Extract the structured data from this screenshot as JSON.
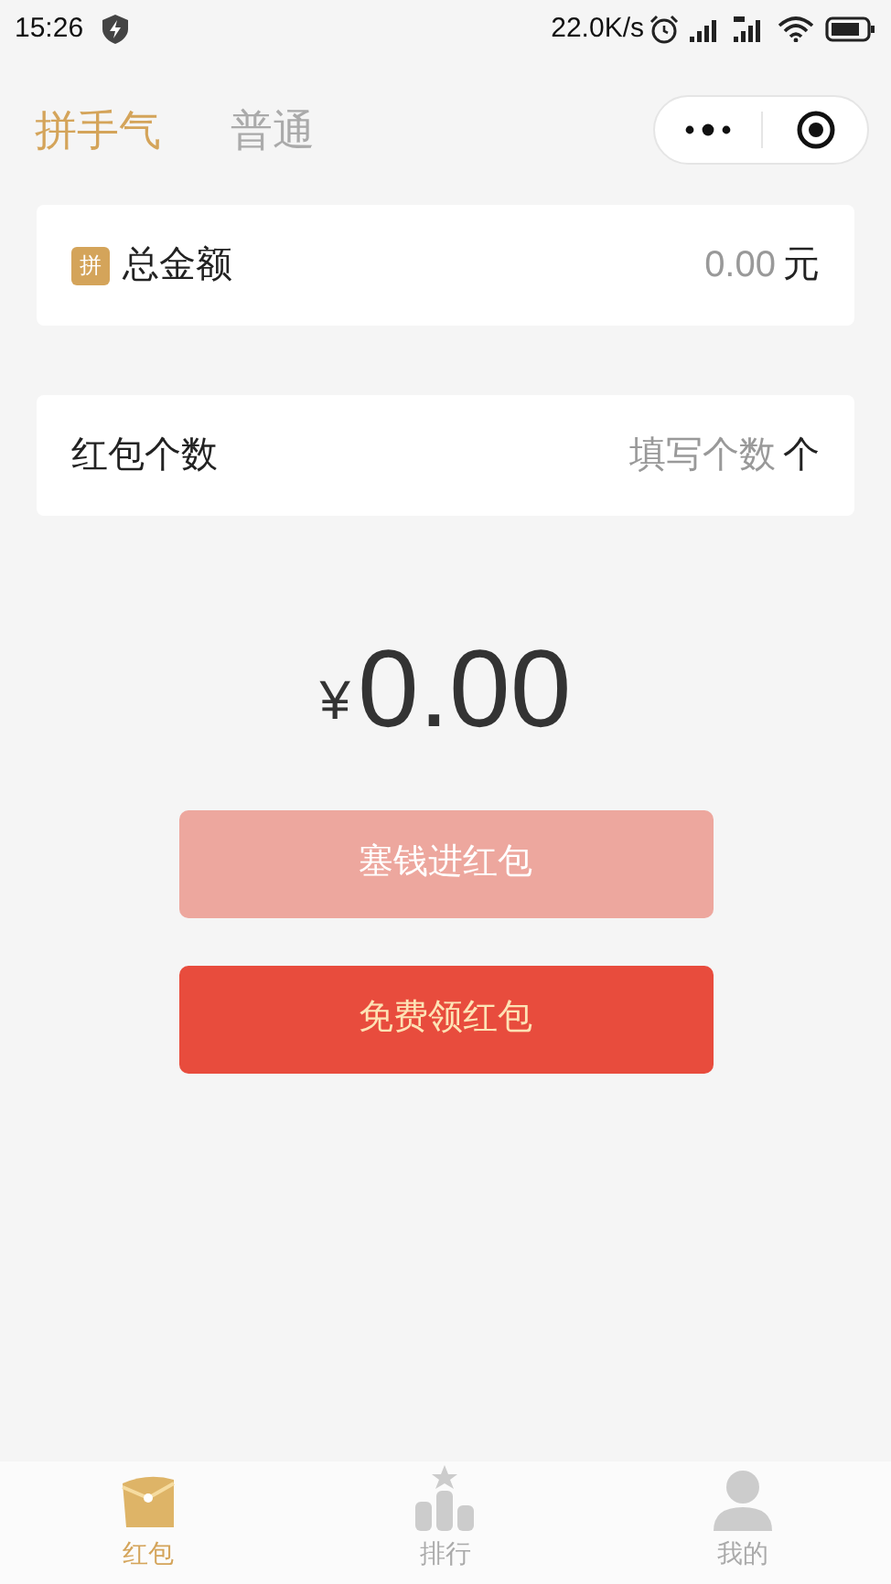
{
  "status_bar": {
    "time": "15:26",
    "speed": "22.0K/s"
  },
  "tabs": [
    {
      "label": "拼手气",
      "selected": true
    },
    {
      "label": "普通",
      "selected": false
    }
  ],
  "fields": [
    {
      "badge": "拼",
      "label": "总金额",
      "placeholder": "0.00",
      "unit": "元"
    },
    {
      "label": "红包个数",
      "placeholder": "填写个数",
      "unit": "个"
    }
  ],
  "amount": {
    "currency": "¥",
    "value": "0.00"
  },
  "buttons": [
    {
      "label": "塞钱进红包",
      "disabled": true
    },
    {
      "label": "免费领红包",
      "disabled": false
    }
  ],
  "tab_bar": [
    {
      "label": "红包",
      "kind": "envelope",
      "selected": true
    },
    {
      "label": "排行",
      "kind": "ranking",
      "selected": false
    },
    {
      "label": "我的",
      "kind": "person",
      "selected": false
    }
  ]
}
